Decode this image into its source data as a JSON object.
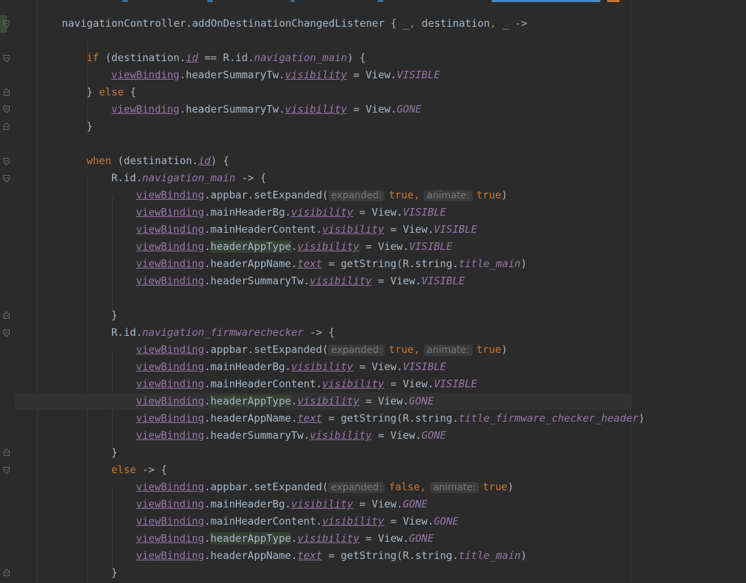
{
  "theme": {
    "background": "#2b2b2b",
    "keyword": "#cc7832",
    "property": "#9876aa",
    "text": "#a9b7c6",
    "hint_text": "#787878"
  },
  "code": {
    "line_1": {
      "a": "navigationController.addOnDestinationChangedListener { _",
      "b": ",",
      "c": " destination",
      "d": ",",
      "e": " _ ->"
    },
    "line_2": {
      "kw": "if",
      "a": " (destination.",
      "prop": "id",
      "b": " == R.id.",
      "const": "navigation_main",
      "c": ") {"
    },
    "line_3": {
      "var": "viewBinding",
      "a": ".headerSummaryTw.",
      "prop": "visibility",
      "b": " = View.",
      "const": "VISIBLE"
    },
    "line_4": {
      "a": "} ",
      "kw": "else",
      "b": " {"
    },
    "line_5": {
      "var": "viewBinding",
      "a": ".headerSummaryTw.",
      "prop": "visibility",
      "b": " = View.",
      "const": "GONE"
    },
    "line_6": {
      "a": "}"
    },
    "line_7": {
      "kw": "when",
      "a": " (destination.",
      "prop": "id",
      "b": ") {"
    },
    "line_8": {
      "a": "R.id.",
      "const": "navigation_main",
      "b": " -> {"
    },
    "line_9": {
      "var": "viewBinding",
      "a": ".appbar.setExpanded(",
      "hint1": "expanded:",
      "v1": "true",
      "c": ",",
      "hint2": "animate:",
      "v2": "true",
      "d": ")"
    },
    "line_10": {
      "var": "viewBinding",
      "a": ".mainHeaderBg.",
      "prop": "visibility",
      "b": " = View.",
      "const": "VISIBLE"
    },
    "line_11": {
      "var": "viewBinding",
      "a": ".mainHeaderContent.",
      "prop": "visibility",
      "b": " = View.",
      "const": "VISIBLE"
    },
    "line_12": {
      "var": "viewBinding",
      "a": ".",
      "hl": "headerAppType",
      "b": ".",
      "prop": "visibility",
      "c": " = View.",
      "const": "VISIBLE"
    },
    "line_13": {
      "var": "viewBinding",
      "a": ".headerAppName.",
      "prop": "text",
      "b": " = getString(R.string.",
      "const": "title_main",
      "c": ")"
    },
    "line_14": {
      "var": "viewBinding",
      "a": ".headerSummaryTw.",
      "prop": "visibility",
      "b": " = View.",
      "const": "VISIBLE"
    },
    "line_15": {
      "a": "}"
    },
    "line_16": {
      "a": "R.id.",
      "const": "navigation_firmwarechecker",
      "b": " -> {"
    },
    "line_17": {
      "var": "viewBinding",
      "a": ".appbar.setExpanded(",
      "hint1": "expanded:",
      "v1": "true",
      "c": ",",
      "hint2": "animate:",
      "v2": "true",
      "d": ")"
    },
    "line_18": {
      "var": "viewBinding",
      "a": ".mainHeaderBg.",
      "prop": "visibility",
      "b": " = View.",
      "const": "VISIBLE"
    },
    "line_19": {
      "var": "viewBinding",
      "a": ".mainHeaderContent.",
      "prop": "visibility",
      "b": " = View.",
      "const": "VISIBLE"
    },
    "line_20": {
      "var": "viewBinding",
      "a": ".",
      "hl": "headerAppType",
      "b": ".",
      "prop": "visibility",
      "c": " = View.",
      "const": "GONE"
    },
    "line_21": {
      "var": "viewBinding",
      "a": ".headerAppName.",
      "prop": "text",
      "b": " = getString(R.string.",
      "const": "title_firmware_checker_header",
      "c": ")"
    },
    "line_22": {
      "var": "viewBinding",
      "a": ".headerSummaryTw.",
      "prop": "visibility",
      "b": " = View.",
      "const": "GONE"
    },
    "line_23": {
      "a": "}"
    },
    "line_24": {
      "kw": "else",
      "a": " -> {"
    },
    "line_25": {
      "var": "viewBinding",
      "a": ".appbar.setExpanded(",
      "hint1": "expanded:",
      "v1": "false",
      "c": ",",
      "hint2": "animate:",
      "v2": "true",
      "d": ")"
    },
    "line_26": {
      "var": "viewBinding",
      "a": ".mainHeaderBg.",
      "prop": "visibility",
      "b": " = View.",
      "const": "GONE"
    },
    "line_27": {
      "var": "viewBinding",
      "a": ".mainHeaderContent.",
      "prop": "visibility",
      "b": " = View.",
      "const": "GONE"
    },
    "line_28": {
      "var": "viewBinding",
      "a": ".",
      "hl": "headerAppType",
      "b": ".",
      "prop": "visibility",
      "c": " = View.",
      "const": "GONE"
    },
    "line_29": {
      "var": "viewBinding",
      "a": ".headerAppName.",
      "prop": "text",
      "b": " = getString(R.string.",
      "const": "title_main",
      "c": ")"
    },
    "line_30": {
      "a": "}"
    }
  }
}
